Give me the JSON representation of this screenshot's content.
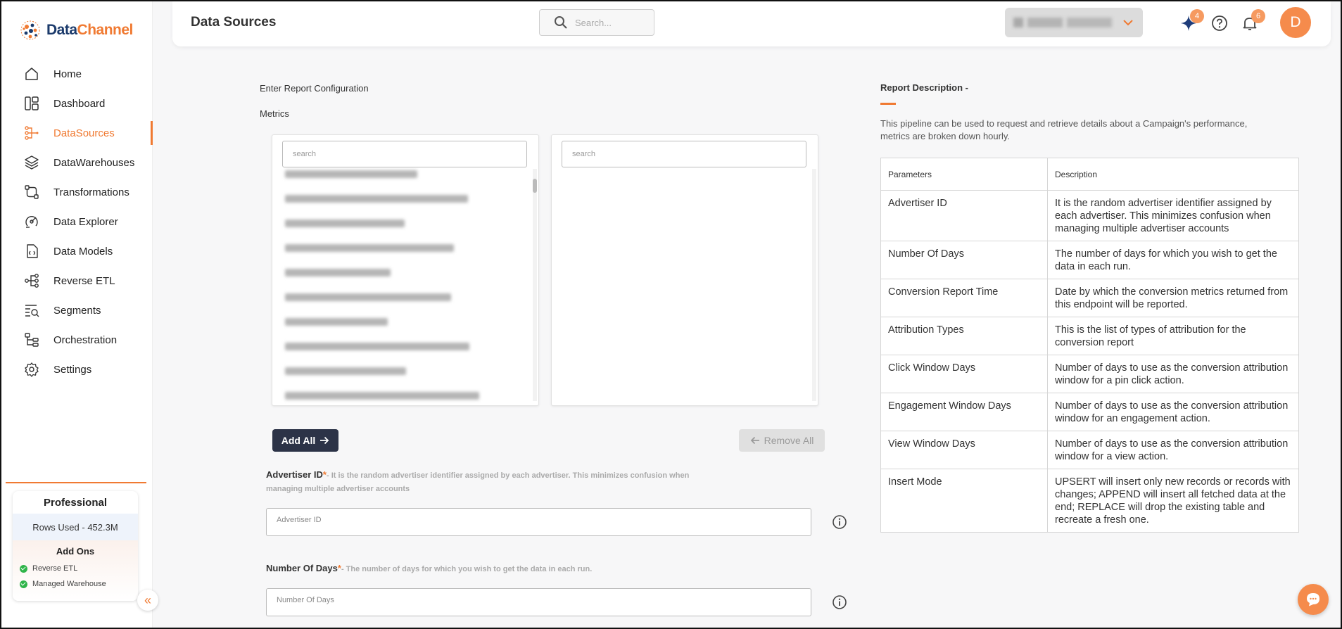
{
  "app": {
    "brand_first": "Data",
    "brand_second": "Channel"
  },
  "sidebar": {
    "items": [
      {
        "label": "Home",
        "icon": "home-icon"
      },
      {
        "label": "Dashboard",
        "icon": "dashboard-icon"
      },
      {
        "label": "DataSources",
        "icon": "datasources-icon",
        "active": true
      },
      {
        "label": "DataWarehouses",
        "icon": "layers-icon"
      },
      {
        "label": "Transformations",
        "icon": "transform-icon"
      },
      {
        "label": "Data Explorer",
        "icon": "explorer-icon"
      },
      {
        "label": "Data Models",
        "icon": "model-icon"
      },
      {
        "label": "Reverse ETL",
        "icon": "reverse-etl-icon"
      },
      {
        "label": "Segments",
        "icon": "segments-icon"
      },
      {
        "label": "Orchestration",
        "icon": "orchestration-icon"
      },
      {
        "label": "Settings",
        "icon": "gear-icon"
      }
    ],
    "plan": {
      "name": "Professional",
      "rows_used": "Rows Used - 452.3M",
      "addons_title": "Add Ons",
      "addons": [
        "Reverse ETL",
        "Managed Warehouse"
      ]
    }
  },
  "header": {
    "title": "Data Sources",
    "search_placeholder": "Search...",
    "notifications": {
      "sparkle_count": "4",
      "bell_count": "6"
    },
    "avatar_initial": "D"
  },
  "main": {
    "config_heading": "Enter Report Configuration",
    "metrics_label": "Metrics",
    "left_search_placeholder": "search",
    "right_search_placeholder": "search",
    "add_all_label": "Add All",
    "remove_all_label": "Remove All",
    "fields": [
      {
        "label": "Advertiser ID",
        "required": "*",
        "hint_line1": "- It is the random advertiser identifier assigned by each advertiser. This minimizes confusion when",
        "hint_line2": "managing multiple advertiser accounts",
        "placeholder": "Advertiser ID"
      },
      {
        "label": "Number Of Days",
        "required": "*",
        "hint_line1": "- The number of days for which you wish to get the data in each run.",
        "placeholder": "Number Of Days"
      }
    ]
  },
  "report": {
    "title": "Report Description -",
    "description": "This pipeline can be used to request and retrieve details about a Campaign's performance, metrics are broken down hourly.",
    "columns": [
      "Parameters",
      "Description"
    ],
    "rows": [
      [
        "Advertiser ID",
        "It is the random advertiser identifier assigned by each advertiser. This minimizes confusion when managing multiple advertiser accounts"
      ],
      [
        "Number Of Days",
        "The number of days for which you wish to get the data in each run."
      ],
      [
        "Conversion Report Time",
        "Date by which the conversion metrics returned from this endpoint will be reported."
      ],
      [
        "Attribution Types",
        "This is the list of types of attribution for the conversion report"
      ],
      [
        "Click Window Days",
        "Number of days to use as the conversion attribution window for a pin click action."
      ],
      [
        "Engagement Window Days",
        "Number of days to use as the conversion attribution window for an engagement action."
      ],
      [
        "View Window Days",
        "Number of days to use as the conversion attribution window for a view action."
      ],
      [
        "Insert Mode",
        "UPSERT will insert only new records or records with changes; APPEND will insert all fetched data at the end; REPLACE will drop the existing table and recreate a fresh one."
      ]
    ]
  },
  "colors": {
    "accent": "#f07a32",
    "dark_button": "#2c3347"
  }
}
